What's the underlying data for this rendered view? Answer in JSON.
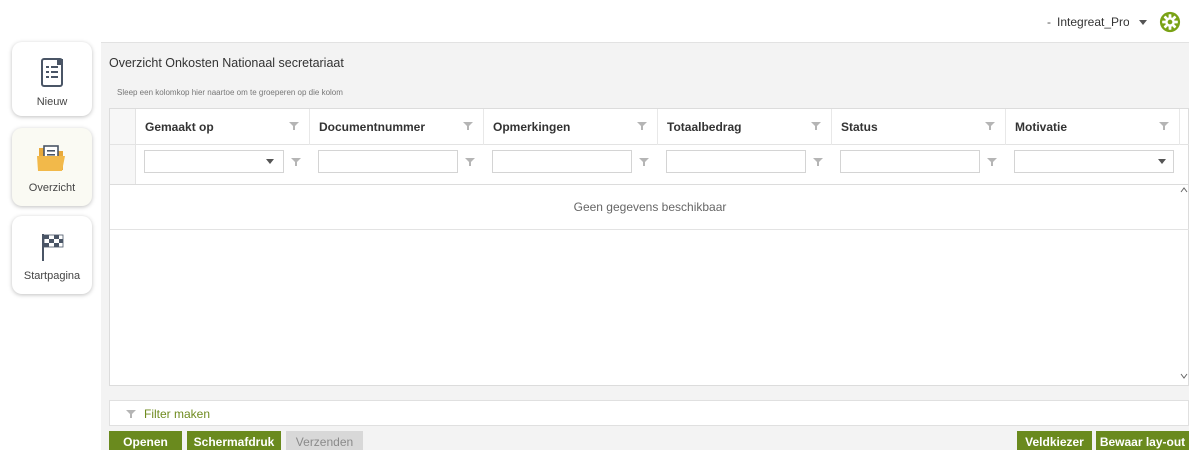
{
  "header": {
    "user_dash": "-",
    "user_name": "Integreat_Proc",
    "accent": "#7aa215"
  },
  "nav": {
    "items": [
      {
        "label": "Nieuw",
        "icon": "document-list-icon"
      },
      {
        "label": "Overzicht",
        "icon": "folder-icon"
      },
      {
        "label": "Startpagina",
        "icon": "checkered-flag-icon"
      }
    ]
  },
  "panel": {
    "title": "Overzicht Onkosten Nationaal secretariaat",
    "group_hint": "Sleep een kolomkop hier naartoe om te groeperen op die kolom"
  },
  "grid": {
    "columns": [
      {
        "label": "Gemaakt op",
        "filter_type": "dropdown"
      },
      {
        "label": "Documentnummer",
        "filter_type": "text"
      },
      {
        "label": "Opmerkingen",
        "filter_type": "text"
      },
      {
        "label": "Totaalbedrag",
        "filter_type": "text"
      },
      {
        "label": "Status",
        "filter_type": "text"
      },
      {
        "label": "Motivatie",
        "filter_type": "dropdown"
      }
    ],
    "empty_message": "Geen gegevens beschikbaar"
  },
  "filterbar": {
    "label": "Filter maken"
  },
  "buttons": {
    "open": "Openen",
    "print": "Schermafdruk",
    "send": "Verzenden",
    "field_chooser": "Veldkiezer",
    "save_layout": "Bewaar lay-out"
  },
  "colors": {
    "primary_button": "#6a8a1e",
    "disabled_button": "#d8d8d8",
    "link": "#6f8b1f"
  }
}
